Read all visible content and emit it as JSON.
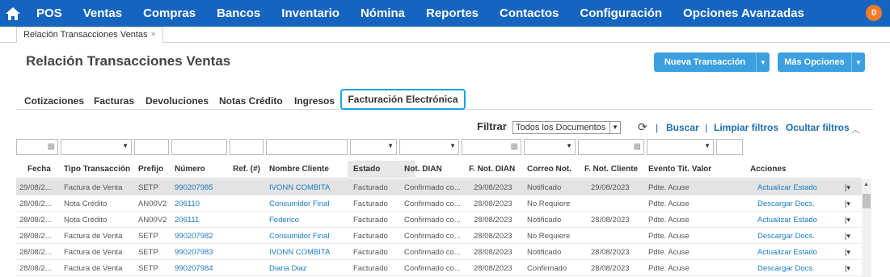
{
  "nav": {
    "home_icon": "home-icon",
    "items": [
      "POS",
      "Ventas",
      "Compras",
      "Bancos",
      "Inventario",
      "Nómina",
      "Reportes",
      "Contactos",
      "Configuración",
      "Opciones Avanzadas"
    ],
    "notification_count": "0",
    "bar_color": "#1565c0"
  },
  "doc_tab": {
    "label": "Relación Transacciones Ventas",
    "close": "×"
  },
  "page_title": "Relación Transacciones Ventas",
  "buttons": {
    "nueva": "Nueva Transacción",
    "mas": "Más Opciones"
  },
  "subtabs": [
    "Cotizaciones",
    "Facturas",
    "Devoluciones",
    "Notas Crédito",
    "Ingresos",
    "Facturación Electrónica"
  ],
  "filter": {
    "label": "Filtrar",
    "selected": "Todos los Documentos",
    "buscar": "Buscar",
    "limpiar": "Limpiar filtros",
    "ocultar": "Ocultar filtros"
  },
  "table": {
    "headers": [
      "Fecha",
      "Tipo Transacción",
      "Prefijo",
      "Número",
      "Ref. (#)",
      "Nombre Cliente",
      "Estado",
      "Not. DIAN",
      "F. Not. DIAN",
      "Correo Not.",
      "F. Not. Cliente",
      "Evento Tit. Valor",
      "Acciones"
    ],
    "rows": [
      {
        "fecha": "29/08/2...",
        "tipo": "Factura de Venta",
        "prefijo": "SETP",
        "numero": "990207985",
        "ref": "",
        "cliente": "IVONN COMBITA",
        "estado": "Facturado",
        "not_dian": "Confirmado co...",
        "f_not_dian": "29/08/2023",
        "correo": "Notificado",
        "f_not_cliente": "29/08/2023",
        "evento": "Pdte. Acuse",
        "accion": "Actualizar Estado"
      },
      {
        "fecha": "28/08/2...",
        "tipo": "Nota Crédito",
        "prefijo": "AN00V2",
        "numero": "206110",
        "ref": "",
        "cliente": "Consumidor Final",
        "estado": "Facturado",
        "not_dian": "Confirmado co...",
        "f_not_dian": "28/08/2023",
        "correo": "No Requiere",
        "f_not_cliente": "",
        "evento": "Pdte. Acuse",
        "accion": "Descargar Docs."
      },
      {
        "fecha": "28/08/2...",
        "tipo": "Nota Crédito",
        "prefijo": "AN00V2",
        "numero": "206111",
        "ref": "",
        "cliente": "Federico",
        "estado": "Facturado",
        "not_dian": "Confirmado co...",
        "f_not_dian": "28/08/2023",
        "correo": "Notificado",
        "f_not_cliente": "28/08/2023",
        "evento": "Pdte. Acuse",
        "accion": "Actualizar Estado"
      },
      {
        "fecha": "28/08/2...",
        "tipo": "Factura de Venta",
        "prefijo": "SETP",
        "numero": "990207982",
        "ref": "",
        "cliente": "Consumidor Final",
        "estado": "Facturado",
        "not_dian": "Confirmado co...",
        "f_not_dian": "28/08/2023",
        "correo": "No Requiere",
        "f_not_cliente": "",
        "evento": "Pdte. Acuse",
        "accion": "Descargar Docs."
      },
      {
        "fecha": "28/08/2...",
        "tipo": "Factura de Venta",
        "prefijo": "SETP",
        "numero": "990207983",
        "ref": "",
        "cliente": "IVONN COMBITA",
        "estado": "Facturado",
        "not_dian": "Confirmado co...",
        "f_not_dian": "28/08/2023",
        "correo": "Notificado",
        "f_not_cliente": "28/08/2023",
        "evento": "Pdte. Acuse",
        "accion": "Actualizar Estado"
      },
      {
        "fecha": "28/08/2...",
        "tipo": "Factura de Venta",
        "prefijo": "SETP",
        "numero": "990207984",
        "ref": "",
        "cliente": "Diana Diaz",
        "estado": "Facturado",
        "not_dian": "Confirmado co...",
        "f_not_dian": "28/08/2023",
        "correo": "Confirmado",
        "f_not_cliente": "28/08/2023",
        "evento": "Pdte. Acuse",
        "accion": "Descargar Docs."
      }
    ]
  }
}
